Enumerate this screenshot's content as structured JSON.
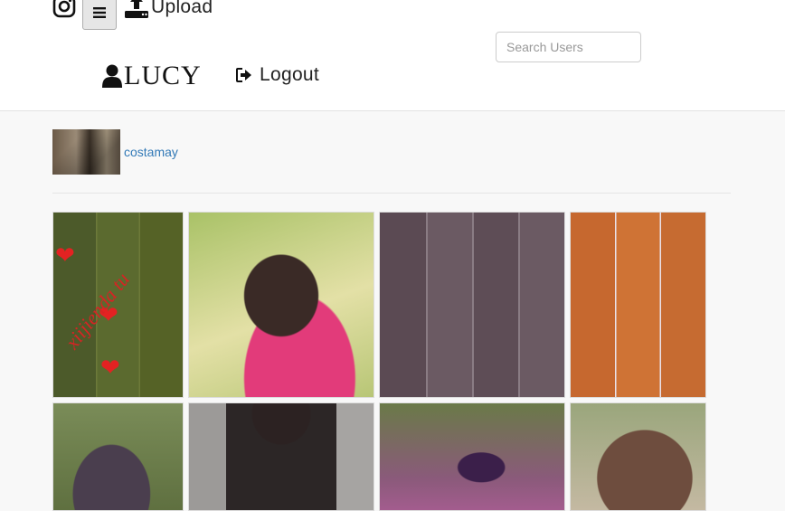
{
  "header": {
    "instagram_icon": "instagram-icon",
    "menu_icon": "hamburger-icon",
    "upload_icon": "upload-icon",
    "upload_label": "Upload",
    "search_placeholder": "Search Users",
    "brand_icon": "user-icon",
    "brand_label": "LUCY",
    "logout_icon": "sign-out-icon",
    "logout_label": "Logout"
  },
  "profile": {
    "username": "costamay"
  },
  "gallery": {
    "photo_overlay_text": "xiijienda tu",
    "photos": [
      "photo-1",
      "photo-2",
      "photo-3",
      "photo-4",
      "photo-5",
      "photo-6",
      "photo-7",
      "photo-8"
    ]
  }
}
